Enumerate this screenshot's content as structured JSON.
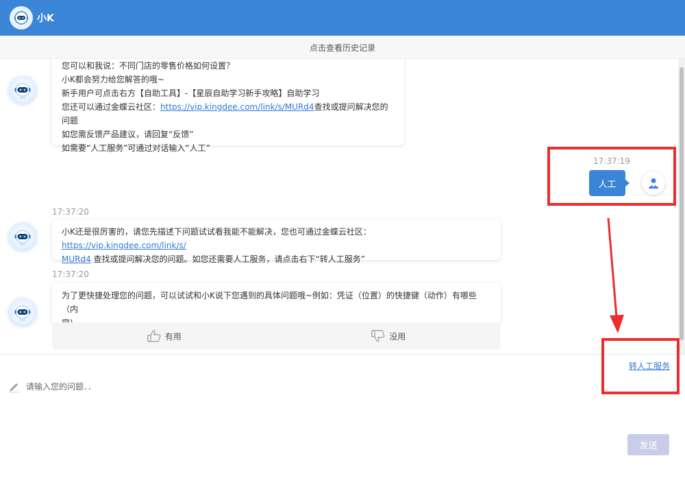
{
  "header": {
    "title": "小K"
  },
  "history": {
    "label": "点击查看历史记录"
  },
  "messages": {
    "m1": {
      "line1": "您可以和我说：不同门店的零售价格如何设置？",
      "line2": "小K都会努力给您解答的哦~",
      "line3": "新手用户可点击右方【自助工具】-【星辰自助学习新手攻略】自助学习",
      "line4_prefix": "您还可以通过金蝶云社区：",
      "line4_link": "https://vip.kingdee.com/link/s/MURd4",
      "line4_suffix": "查找或提问解决您的问题",
      "line5": "如您需反馈产品建议，请回复“反馈”",
      "line6": "如需要“人工服务”可通过对话输入“人工”"
    },
    "user_time": "17:37:19",
    "user_text": "人工",
    "m2_time": "17:37:20",
    "m2": {
      "prefix": "小K还是很厉害的，请您先描述下问题试试看我能不能解决，您也可通过金蝶云社区：",
      "link_part1": "https://vip.kingdee.com/link/s/",
      "link_part2": "MURd4",
      "suffix": " 查找或提问解决您的问题。如您还需要人工服务，请点击右下“转人工服务”"
    },
    "m3_time": "17:37:20",
    "m3": {
      "line1": "为了更快捷处理您的问题，可以试试和小K说下您遇到的具体问题哦~例如：凭证（位置）的快捷键（动作）有哪些（内",
      "line2": "容)"
    },
    "feedback": {
      "useful": "有用",
      "useless": "没用"
    }
  },
  "input": {
    "transfer_label": "转人工服务",
    "placeholder": "请输入您的问题．．",
    "send_label": "发送"
  },
  "colors": {
    "header": "#3a85d8",
    "annotation": "#ef2b2b",
    "link": "#2f7ad6",
    "send_disabled": "#c9cdea"
  }
}
